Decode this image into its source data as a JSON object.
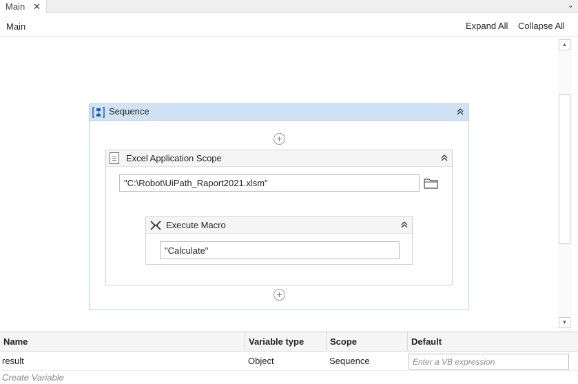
{
  "tab": {
    "label": "Main",
    "close_glyph": "✕",
    "dropdown_glyph": "⌄"
  },
  "header": {
    "breadcrumb": "Main",
    "expand_all": "Expand All",
    "collapse_all": "Collapse All"
  },
  "scrollbar": {
    "up_glyph": "▲",
    "down_glyph": "▼"
  },
  "sequence": {
    "title": "Sequence",
    "icon": "sequence-icon",
    "collapse_glyph": "⌃⌃",
    "add_glyph": "+"
  },
  "excel_scope": {
    "title": "Excel Application Scope",
    "icon": "excel-document-icon",
    "workbook_path": "\"C:\\Robot\\UiPath_Raport2021.xlsm\"",
    "browse_icon": "folder-icon"
  },
  "execute_macro": {
    "title": "Execute Macro",
    "icon": "execute-macro-icon",
    "macro_name": "\"Calculate\""
  },
  "variables": {
    "columns": [
      "Name",
      "Variable type",
      "Scope",
      "Default"
    ],
    "rows": [
      {
        "name": "result",
        "type": "Object",
        "scope": "Sequence",
        "default_placeholder": "Enter a VB expression"
      }
    ],
    "create_label": "Create Variable"
  },
  "colors": {
    "sequence_header": "#cfe3f4",
    "sequence_border": "#b9cfe4",
    "activity_header": "#f5f5f5"
  }
}
